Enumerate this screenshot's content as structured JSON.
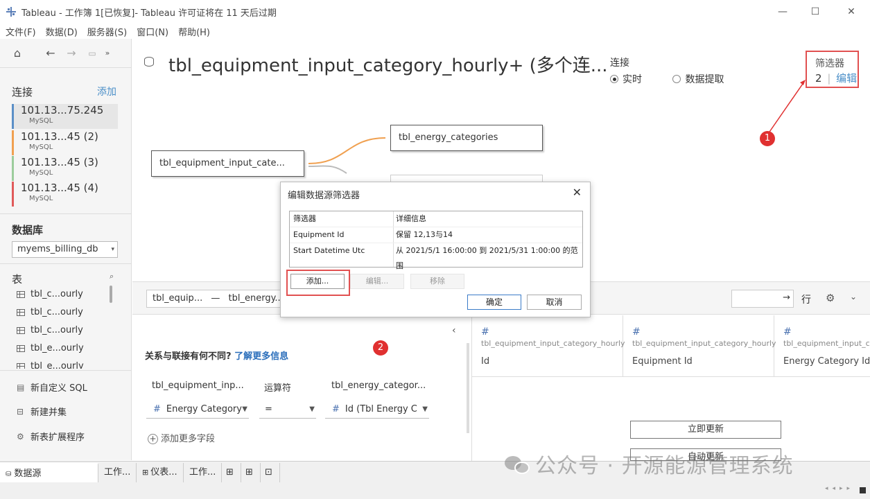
{
  "window": {
    "title": "Tableau - 工作簿 1[已恢复]- Tableau 许可证将在 11 天后过期",
    "minimize": "—",
    "maximize": "☐",
    "close": "✕"
  },
  "menu": [
    "文件(F)",
    "数据(D)",
    "服务器(S)",
    "窗口(N)",
    "帮助(H)"
  ],
  "left": {
    "connections_heading": "连接",
    "add_label": "添加",
    "connections": [
      {
        "name": "101.13...75.245",
        "type": "MySQL",
        "color": "#5b8fc7"
      },
      {
        "name": "101.13...45 (2)",
        "type": "MySQL",
        "color": "#f0a050"
      },
      {
        "name": "101.13...45 (3)",
        "type": "MySQL",
        "color": "#9ccc9c"
      },
      {
        "name": "101.13...45 (4)",
        "type": "MySQL",
        "color": "#e05a5a"
      }
    ],
    "database_heading": "数据库",
    "database_value": "myems_billing_db",
    "tables_heading": "表",
    "tables": [
      "tbl_c...ourly",
      "tbl_c...ourly",
      "tbl_c...ourly",
      "tbl_e...ourly",
      "tbl_e...ourly"
    ],
    "actions": [
      "新自定义 SQL",
      "新建并集",
      "新表扩展程序"
    ]
  },
  "datasource": {
    "title": "tbl_equipment_input_category_hourly+ (多个连...",
    "connection_label": "连接",
    "live_label": "实时",
    "extract_label": "数据提取",
    "filters_label": "筛选器",
    "filters_count": "2",
    "filters_edit": "编辑"
  },
  "canvas": {
    "left_table": "tbl_equipment_input_cate...",
    "right_table": "tbl_energy_categories"
  },
  "join": {
    "pill_left": "tbl_equip...",
    "pill_right": "tbl_energy...",
    "info_text": "关系与联接有何不同?",
    "learn_more": "了解更多信息",
    "left_col_header": "tbl_equipment_inp...",
    "op_header": "运算符",
    "right_col_header": "tbl_energy_categor...",
    "left_field": "Energy Category",
    "operator": "=",
    "right_field": "Id (Tbl Energy C",
    "add_field": "添加更多字段"
  },
  "grid": {
    "rows_label": "行",
    "columns": [
      {
        "table": "tbl_equipment_input_category_hourly",
        "field": "Id"
      },
      {
        "table": "tbl_equipment_input_category_hourly",
        "field": "Equipment Id"
      },
      {
        "table": "tbl_equipment_input_cate",
        "field": "Energy Category Id"
      }
    ],
    "update_now": "立即更新",
    "auto_update": "自动更新"
  },
  "tabs": [
    "数据源",
    "工作...",
    "仪表...",
    "工作..."
  ],
  "dialog": {
    "title": "编辑数据源筛选器",
    "col_filter": "筛选器",
    "col_detail": "详细信息",
    "rows": [
      {
        "filter": "Equipment Id",
        "detail": "保留 12,13与14"
      },
      {
        "filter": "Start Datetime Utc",
        "detail": "从 2021/5/1 16:00:00 到 2021/5/31 1:00:00 的范围"
      }
    ],
    "add": "添加...",
    "edit": "编辑...",
    "remove": "移除",
    "ok": "确定",
    "cancel": "取消"
  },
  "annotations": {
    "marker1": "1",
    "marker2": "2",
    "color": "#e03030"
  },
  "watermark": "公众号 · 开源能源管理系统"
}
